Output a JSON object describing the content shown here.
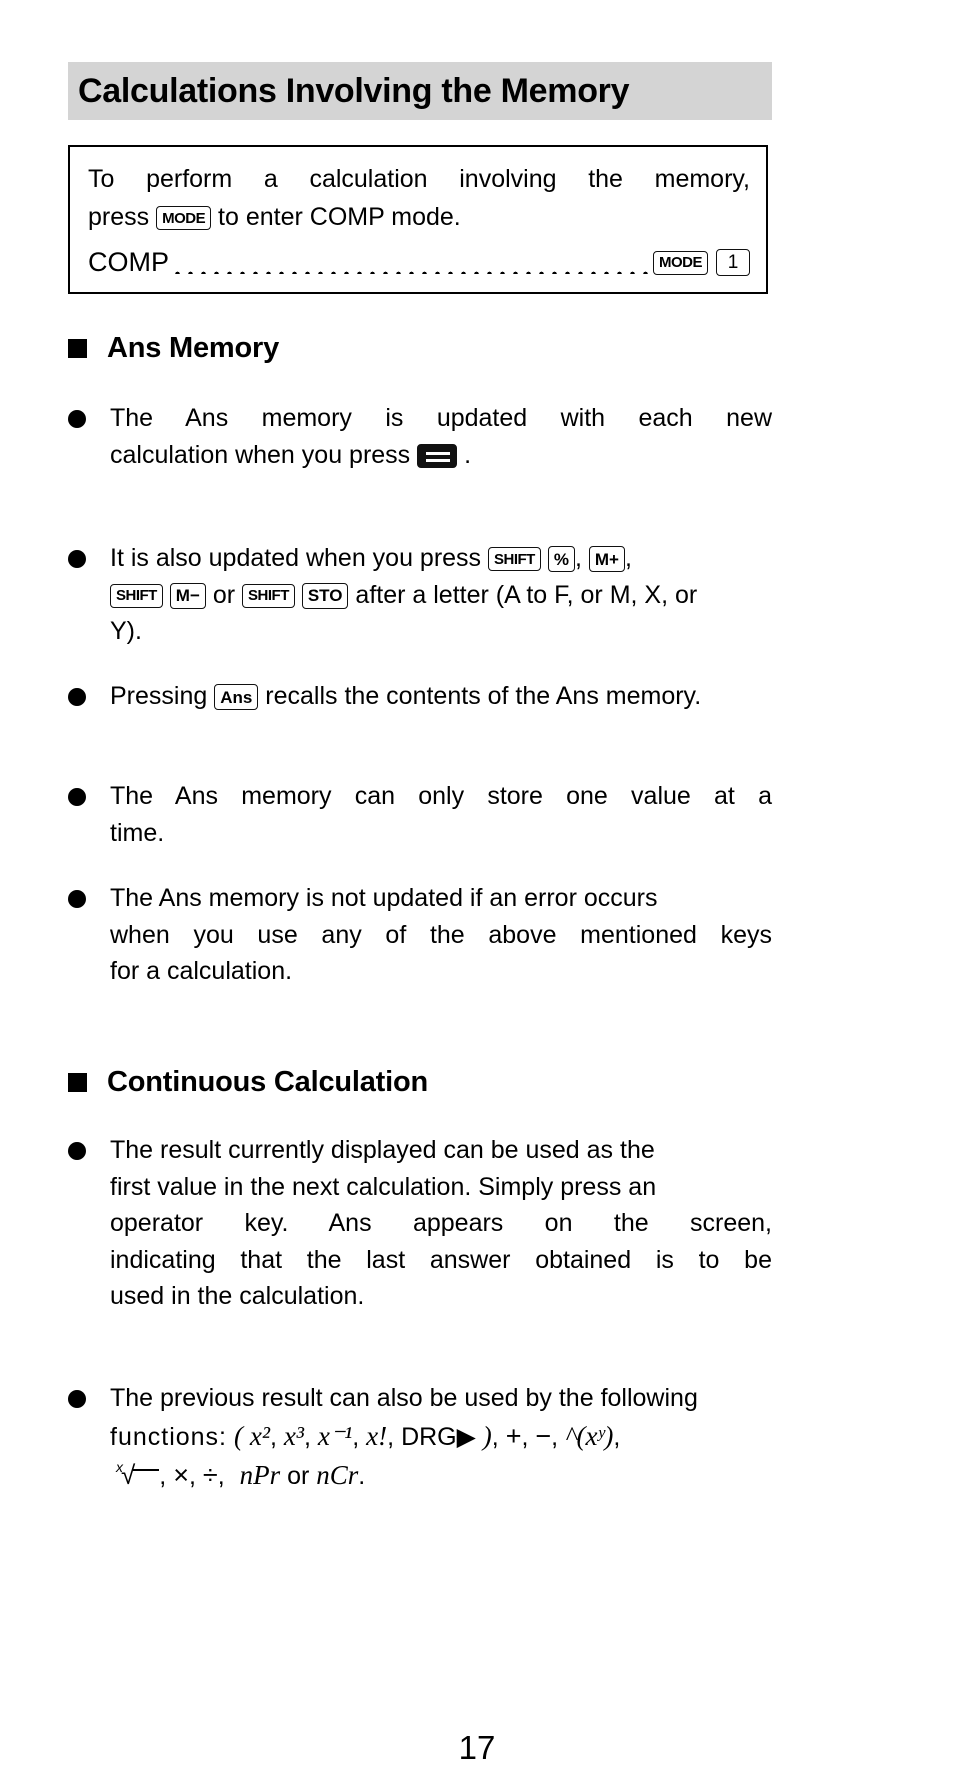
{
  "page": {
    "title": "Calculations Involving the Memory",
    "page_number": "17"
  },
  "mode_box": {
    "line1": "To perform a calculation involving the memory,",
    "line2_before": "press",
    "key_mode": "MODE",
    "line2_after": "to enter COMP mode.",
    "comp_label": "COMP",
    "comp_key_mode": "MODE",
    "comp_key_num": "1"
  },
  "sections": [
    {
      "heading": "Ans Memory",
      "items": [
        {
          "lines": [
            "The  Ans  memory  is  updated  with  each  new",
            "calculation when you press"
          ],
          "trailing_key": "=",
          "trailing_text": "."
        },
        {
          "line1_text": "It  is  also  updated  when  you  press",
          "keys1": [
            "SHIFT",
            "%"
          ],
          "sep1": ",",
          "keys1b": [
            "M+"
          ],
          "sep1b": ",",
          "line2_keys": [
            "SHIFT",
            "M−"
          ],
          "line2_mid": "or",
          "line2_keys_b": [
            "SHIFT",
            "STO"
          ],
          "line2_text": "after a letter (A to F, or M, X, or",
          "line3_text": "Y)."
        },
        {
          "pre": "Pressing",
          "key": "Ans",
          "post": "recalls the contents of the Ans memory."
        },
        {
          "lines": [
            "The  Ans  memory  can  only  store  one  value  at  a",
            "time."
          ]
        },
        {
          "lines": [
            "The Ans memory is not updated if an error occurs",
            "when  you  use  any  of  the  above  mentioned  keys",
            "for a calculation."
          ]
        }
      ]
    },
    {
      "heading": "Continuous Calculation",
      "items": [
        {
          "lines": [
            "The result currently displayed can be used as the",
            "first value in the next calculation. Simply press an",
            "operator  key.  Ans  appears  on  the  screen,",
            "indicating  that  the  last  answer  obtained  is  to  be",
            "used in the calculation."
          ]
        },
        {
          "lines": [
            "The previous result can also be used by the following"
          ],
          "math_line1": {
            "prefix": "functions:",
            "open": "(",
            "terms": [
              "x²",
              "x³",
              "x⁻¹",
              "x!",
              "DRG▶"
            ],
            "close": ")",
            "ops": [
              "+",
              "−",
              "^(xʸ)"
            ]
          },
          "math_line2": {
            "radical_index": "x",
            "radical": "√",
            "ops": [
              "×",
              "÷"
            ],
            "perm": "nPr",
            "conj": "or",
            "comb": "nCr",
            "period": "."
          }
        }
      ]
    }
  ]
}
